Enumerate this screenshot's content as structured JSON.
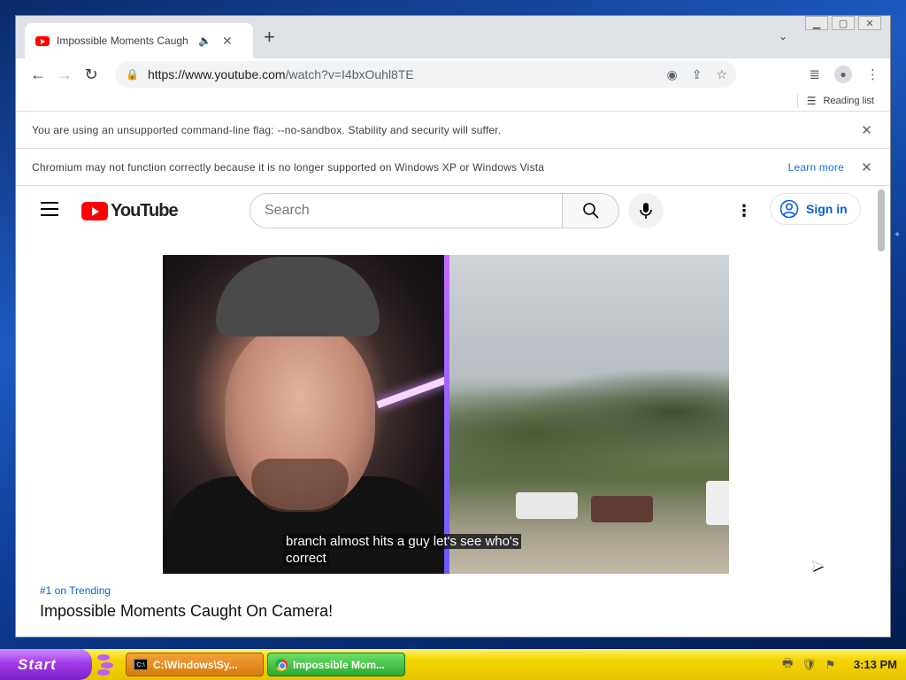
{
  "browser": {
    "tab": {
      "title": "Impossible Moments Caugh",
      "audio_icon": "speaker-icon"
    },
    "url": {
      "host": "https://www.youtube.com",
      "path": "/watch?v=I4bxOuhl8TE"
    },
    "bookmarks": {
      "reading_list": "Reading list"
    },
    "infobars": [
      {
        "text": "You are using an unsupported command-line flag: --no-sandbox. Stability and security will suffer."
      },
      {
        "text": "Chromium may not function correctly because it is no longer supported on Windows XP or Windows Vista",
        "link": "Learn more"
      }
    ]
  },
  "youtube": {
    "logo_text": "YouTube",
    "search_placeholder": "Search",
    "sign_in": "Sign in",
    "video": {
      "caption_line1": "branch almost hits a guy let's see who's",
      "caption_line2": "correct",
      "trending": "#1 on Trending",
      "title": "Impossible Moments Caught On Camera!"
    }
  },
  "taskbar": {
    "start_label": "Start",
    "tasks": [
      {
        "label": "C:\\Windows\\Sy..."
      },
      {
        "label": "Impossible Mom..."
      }
    ],
    "clock": "3:13 PM"
  },
  "colors": {
    "youtube_red": "#ff0000",
    "link_blue": "#065fd4",
    "taskbar_yellow": "#f3d500",
    "start_purple": "#a23ce8"
  }
}
